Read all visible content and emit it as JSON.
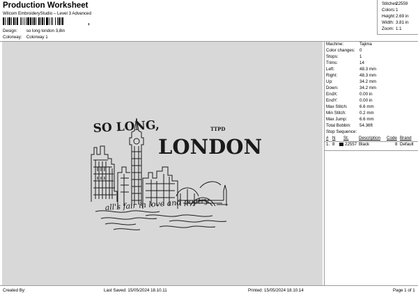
{
  "header": {
    "title": "Production Worksheet",
    "software": "Wilcom EmbroideryStudio – Level 3 Advanced",
    "barcode_suffix": ",",
    "design_label": "Design:",
    "design_value": "so long london 3,8in",
    "colorway_label": "Colorway:",
    "colorway_value": "Colorway 1"
  },
  "stats": [
    {
      "label": "Stitches:",
      "value": "22559"
    },
    {
      "label": "Colors:",
      "value": "1"
    },
    {
      "label": "Height:",
      "value": "2.69 in"
    },
    {
      "label": "Width:",
      "value": "3.81 in"
    },
    {
      "label": "Zoom:",
      "value": "1:1"
    }
  ],
  "design": {
    "headline_left": "SO LONG,",
    "headline_main": "LONDON",
    "tag": "TTPD",
    "script_line": "all's fair in love and poetry",
    "thread_color": "#1a1a1a"
  },
  "machine_info": [
    {
      "label": "Machine:",
      "value": "Tajima"
    },
    {
      "label": "Color changes:",
      "value": "0"
    },
    {
      "label": "Stops:",
      "value": "1"
    },
    {
      "label": "Trims:",
      "value": "14"
    },
    {
      "label": "Left:",
      "value": "48.3 mm"
    },
    {
      "label": "Right:",
      "value": "48.3 mm"
    },
    {
      "label": "Up:",
      "value": "34.2 mm"
    },
    {
      "label": "Down:",
      "value": "34.2 mm"
    },
    {
      "label": "EndX:",
      "value": "0.00 in"
    },
    {
      "label": "EndY:",
      "value": "0.00 in"
    },
    {
      "label": "Max Stitch:",
      "value": "6.6 mm"
    },
    {
      "label": "Min Stitch:",
      "value": "0.2 mm"
    },
    {
      "label": "Max Jump:",
      "value": "6.6 mm"
    },
    {
      "label": "Total Bobbin:",
      "value": "54.36ft"
    }
  ],
  "stop_sequence": {
    "label": "Stop Sequence:",
    "headers": {
      "num": "#",
      "n": "N",
      "st": "St.",
      "description": "Description",
      "code": "Code",
      "brand": "Brand"
    },
    "rows": [
      {
        "num": "1.",
        "n": "8",
        "swatch": "#111111",
        "st": "22557",
        "description": "Black",
        "code": "8",
        "brand": "Default"
      }
    ]
  },
  "footer": {
    "created_by": "Created By:",
    "last_saved": "Last Saved: 15/05/2024 18.10.11",
    "printed": "Printed: 15/05/2024 18.10.14",
    "page": "Page 1 of 1"
  }
}
